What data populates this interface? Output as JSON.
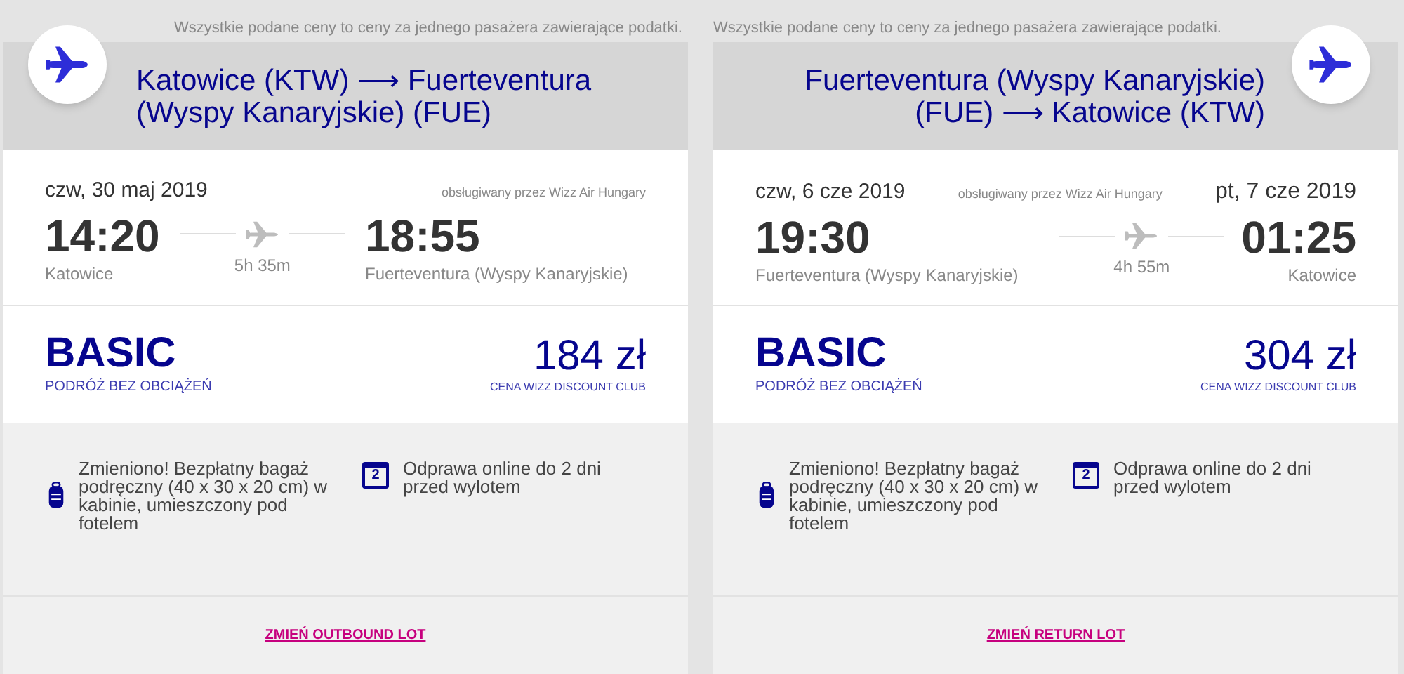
{
  "legs": [
    {
      "kind": "outbound",
      "disclaimer": "Wszystkie podane ceny to ceny za jednego pasażera zawierające podatki.",
      "route": "Katowice (KTW) ⟶ Fuerteventura (Wyspy Kanaryjskie) (FUE)",
      "departure_date": "czw, 30 maj 2019",
      "operator": "obsługiwany przez Wizz Air Hungary",
      "departure_time": "14:20",
      "departure_city": "Katowice",
      "duration": "5h 35m",
      "arrival_time": "18:55",
      "arrival_city": "Fuerteventura (Wyspy Kanaryjskie)",
      "fare": "BASIC",
      "fare_subtitle": "PODRÓŻ BEZ OBCIĄŻEŃ",
      "price": "184 zł",
      "price_note": "CENA WIZZ DISCOUNT CLUB",
      "features": [
        {
          "kind": "bag",
          "text": "Zmieniono! Bezpłatny bagaż podręczny (40 x 30 x 20 cm) w kabinie, umieszczony pod fotelem"
        },
        {
          "kind": "calendar",
          "icon_text": "2",
          "text": "Odprawa online do 2 dni przed wylotem"
        }
      ],
      "change_link": "ZMIEŃ OUTBOUND LOT"
    },
    {
      "kind": "return",
      "disclaimer": "Wszystkie podane ceny to ceny za jednego pasażera zawierające podatki.",
      "route": "Fuerteventura (Wyspy Kanaryjskie) (FUE) ⟶ Katowice (KTW)",
      "departure_date": "czw, 6 cze 2019",
      "operator": "obsługiwany przez Wizz Air Hungary",
      "arrival_date": "pt, 7 cze 2019",
      "departure_time": "19:30",
      "departure_city": "Fuerteventura (Wyspy Kanaryjskie)",
      "duration": "4h 55m",
      "arrival_time": "01:25",
      "arrival_city": "Katowice",
      "fare": "BASIC",
      "fare_subtitle": "PODRÓŻ BEZ OBCIĄŻEŃ",
      "price": "304 zł",
      "price_note": "CENA WIZZ DISCOUNT CLUB",
      "features": [
        {
          "kind": "bag",
          "text": "Zmieniono! Bezpłatny bagaż podręczny (40 x 30 x 20 cm) w kabinie, umieszczony pod fotelem"
        },
        {
          "kind": "calendar",
          "icon_text": "2",
          "text": "Odprawa online do 2 dni przed wylotem"
        }
      ],
      "change_link": "ZMIEŃ RETURN LOT"
    }
  ]
}
